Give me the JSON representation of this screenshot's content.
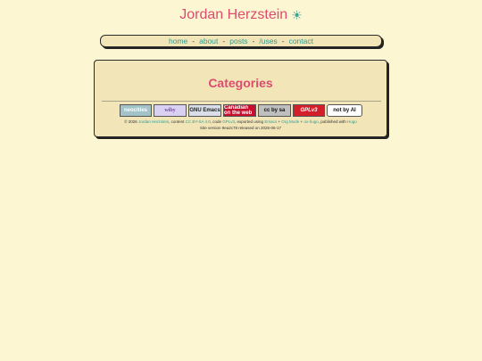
{
  "site": {
    "title": "Jordan Herzstein",
    "theme_toggle": "☀"
  },
  "nav": {
    "items": [
      {
        "label": "home"
      },
      {
        "label": "about"
      },
      {
        "label": "posts"
      },
      {
        "label": "/uses"
      },
      {
        "label": "contact"
      }
    ],
    "separator": "-"
  },
  "page": {
    "title": "Categories"
  },
  "badges": [
    {
      "name": "neocities-badge",
      "text": "neocities"
    },
    {
      "name": "wiby-badge",
      "text": "wiby"
    },
    {
      "name": "gnu-emacs-badge",
      "text": "GNU Emacs"
    },
    {
      "name": "canadian-badge",
      "text": "Canadian on the web"
    },
    {
      "name": "cc-badge",
      "text": "cc by sa"
    },
    {
      "name": "gplv3-badge",
      "text": "GPLv3"
    },
    {
      "name": "not-by-ai-badge",
      "text": "not by AI"
    }
  ],
  "footer": {
    "copyright": "© 2026",
    "author": "Jordan Herzstein",
    "content_text": ", content",
    "content_license": "CC BY-SA 4.0",
    "code_text": ", code",
    "code_license": "GPLv3",
    "exported_text": ", exported using",
    "emacs": "Emacs",
    "plus1": "+",
    "org_mode": "Org Mode",
    "plus2": "+",
    "ox_hugo": "ox-hugo",
    "published_text": ", published with",
    "hugo": "Hugo",
    "version_line": "Site version 9ea2c78 released on 2026-06-17"
  },
  "colors": {
    "background": "#fdf6d3",
    "accent": "#dc4c6f",
    "link": "#2f9a8f",
    "panel": "#f2e6b8"
  }
}
